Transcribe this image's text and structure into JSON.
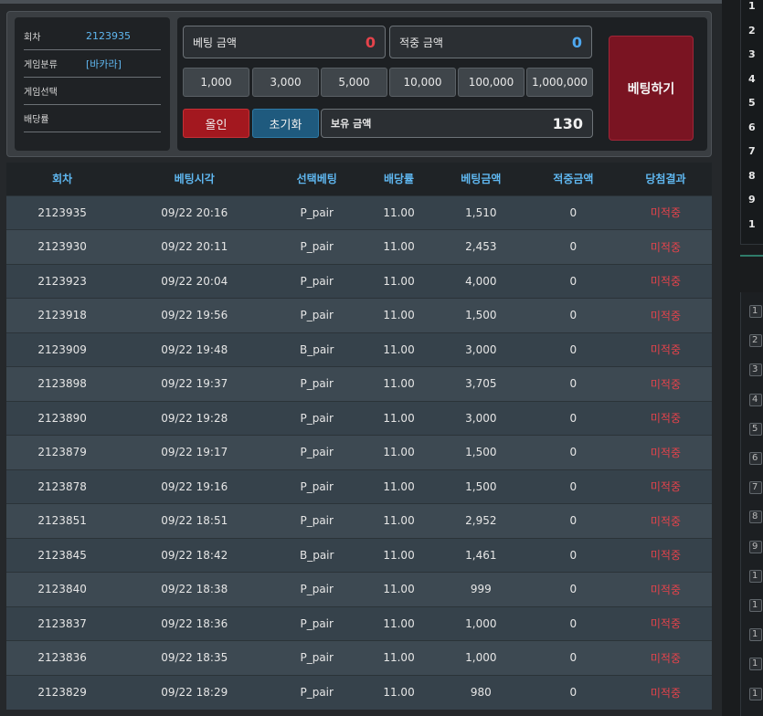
{
  "info": {
    "round_label": "회차",
    "round_value": "2123935",
    "category_label": "게임분류",
    "category_value": "[바카라]",
    "select_label": "게임선택",
    "select_value": "",
    "odds_label": "배당률",
    "odds_value": ""
  },
  "controls": {
    "bet_amount_label": "베팅 금액",
    "bet_amount_value": "0",
    "win_amount_label": "적중 금액",
    "win_amount_value": "0",
    "chips": [
      "1,000",
      "3,000",
      "5,000",
      "10,000",
      "100,000",
      "1,000,000"
    ],
    "allin_label": "올인",
    "reset_label": "초기화",
    "balance_label": "보유 금액",
    "balance_value": "130",
    "bet_button_label": "베팅하기"
  },
  "table": {
    "headers": [
      "회차",
      "베팅시각",
      "선택베팅",
      "배당률",
      "베팅금액",
      "적중금액",
      "당첨결과"
    ],
    "rows": [
      [
        "2123935",
        "09/22 20:16",
        "P_pair",
        "11.00",
        "1,510",
        "0",
        "미적중"
      ],
      [
        "2123930",
        "09/22 20:11",
        "P_pair",
        "11.00",
        "2,453",
        "0",
        "미적중"
      ],
      [
        "2123923",
        "09/22 20:04",
        "P_pair",
        "11.00",
        "4,000",
        "0",
        "미적중"
      ],
      [
        "2123918",
        "09/22 19:56",
        "P_pair",
        "11.00",
        "1,500",
        "0",
        "미적중"
      ],
      [
        "2123909",
        "09/22 19:48",
        "B_pair",
        "11.00",
        "3,000",
        "0",
        "미적중"
      ],
      [
        "2123898",
        "09/22 19:37",
        "P_pair",
        "11.00",
        "3,705",
        "0",
        "미적중"
      ],
      [
        "2123890",
        "09/22 19:28",
        "P_pair",
        "11.00",
        "3,000",
        "0",
        "미적중"
      ],
      [
        "2123879",
        "09/22 19:17",
        "P_pair",
        "11.00",
        "1,500",
        "0",
        "미적중"
      ],
      [
        "2123878",
        "09/22 19:16",
        "P_pair",
        "11.00",
        "1,500",
        "0",
        "미적중"
      ],
      [
        "2123851",
        "09/22 18:51",
        "P_pair",
        "11.00",
        "2,952",
        "0",
        "미적중"
      ],
      [
        "2123845",
        "09/22 18:42",
        "B_pair",
        "11.00",
        "1,461",
        "0",
        "미적중"
      ],
      [
        "2123840",
        "09/22 18:38",
        "P_pair",
        "11.00",
        "999",
        "0",
        "미적중"
      ],
      [
        "2123837",
        "09/22 18:36",
        "P_pair",
        "11.00",
        "1,000",
        "0",
        "미적중"
      ],
      [
        "2123836",
        "09/22 18:35",
        "P_pair",
        "11.00",
        "1,000",
        "0",
        "미적중"
      ],
      [
        "2123829",
        "09/22 18:29",
        "P_pair",
        "11.00",
        "980",
        "0",
        "미적중"
      ]
    ]
  },
  "side": {
    "top_numbers": [
      "1",
      "2",
      "3",
      "4",
      "5",
      "6",
      "7",
      "8",
      "9",
      "1"
    ],
    "bottom_items": [
      "1",
      "2",
      "3",
      "4",
      "5",
      "6",
      "7",
      "8",
      "9",
      "1",
      "1",
      "1",
      "1",
      "1"
    ]
  },
  "colors": {
    "accent_blue": "#5fb7f0",
    "loss_red": "#e5434b",
    "bet_button": "#7a1422",
    "allin_button": "#a3181f",
    "reset_button": "#1f5a7e"
  }
}
